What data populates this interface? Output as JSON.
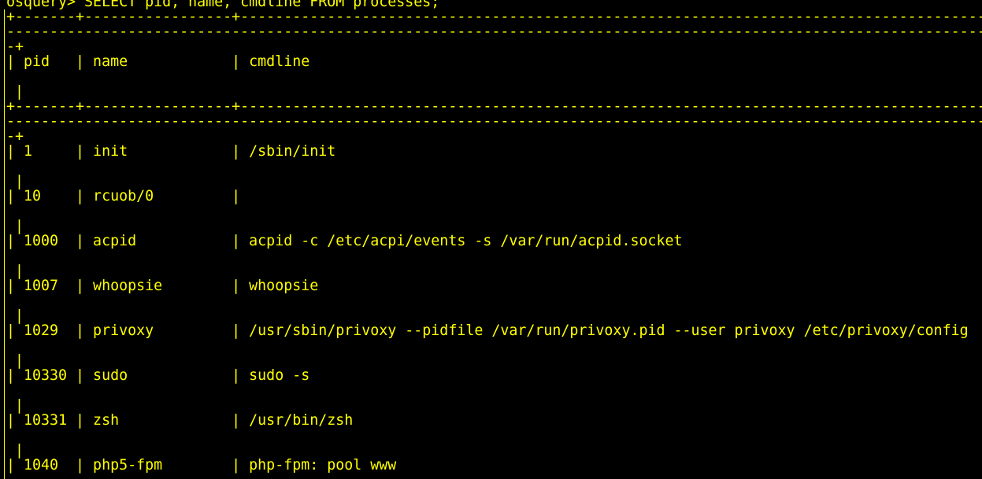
{
  "terminal": {
    "prompt_line": "osquery> SELECT pid, name, cmdline FROM processes;",
    "top_border": "+-------+-----------------+----------------------------------------------------------------------------------------------------",
    "wrap_dashes": "----------------------------------------------------------------------------------------------------------------------------------",
    "wrap_close": "-+",
    "header_row": "| pid   | name            | cmdline",
    "trailing_bar": " |",
    "mid_border": "+-------+-----------------+----------------------------------------------------------------------------------------------------",
    "rows": [
      {
        "text": "| 1     | init            | /sbin/init",
        "trailing": " |"
      },
      {
        "text": "| 10    | rcuob/0         |",
        "trailing": " |"
      },
      {
        "text": "| 1000  | acpid           | acpid -c /etc/acpi/events -s /var/run/acpid.socket",
        "trailing": " |"
      },
      {
        "text": "| 1007  | whoopsie        | whoopsie",
        "trailing": " |"
      },
      {
        "text": "| 1029  | privoxy         | /usr/sbin/privoxy --pidfile /var/run/privoxy.pid --user privoxy /etc/privoxy/config",
        "trailing": " |"
      },
      {
        "text": "| 10330 | sudo            | sudo -s",
        "trailing": " |"
      },
      {
        "text": "| 10331 | zsh             | /usr/bin/zsh",
        "trailing": " |"
      },
      {
        "text": "| 1040  | php5-fpm        | php-fpm: pool www"
      }
    ],
    "colors": {
      "background": "#000000",
      "text": "#ffff00"
    }
  }
}
